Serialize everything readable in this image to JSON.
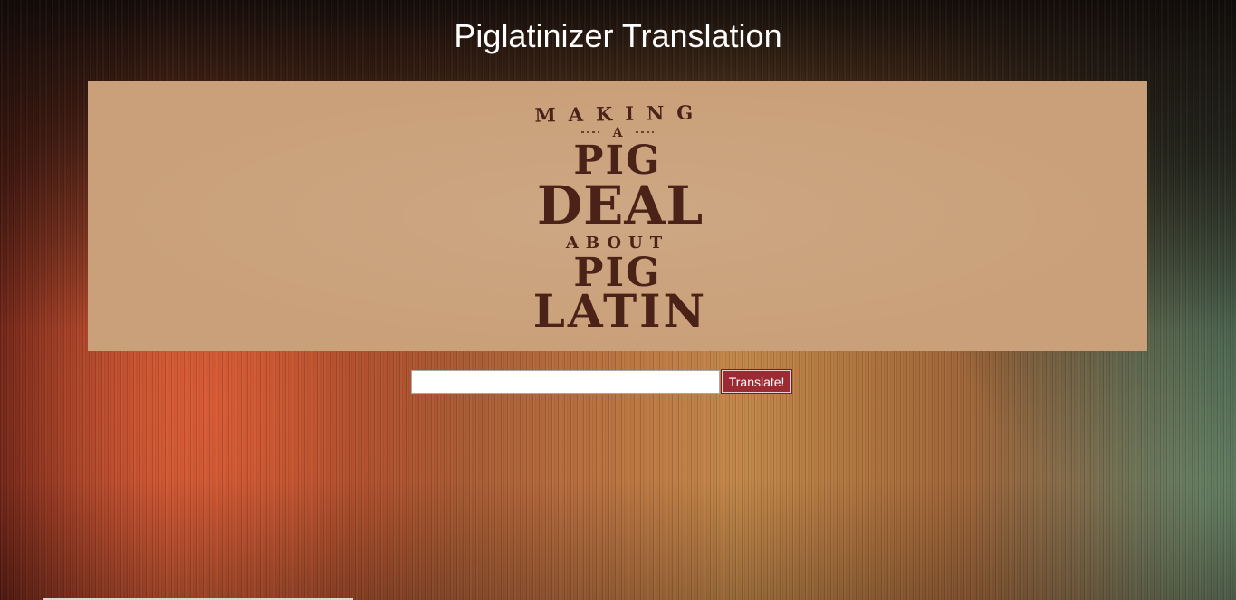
{
  "page": {
    "title": "Piglatinizer Translation"
  },
  "banner": {
    "line1": "MAKING",
    "line2": "A",
    "line3": "PIG",
    "line4": "DEAL",
    "line5": "ABOUT",
    "line6": "PIG",
    "line7": "LATIN",
    "text_color": "#4a2218",
    "background_color": "#c9a079"
  },
  "form": {
    "input_value": "",
    "button_label": "Translate!",
    "button_color": "#9b2a32"
  }
}
